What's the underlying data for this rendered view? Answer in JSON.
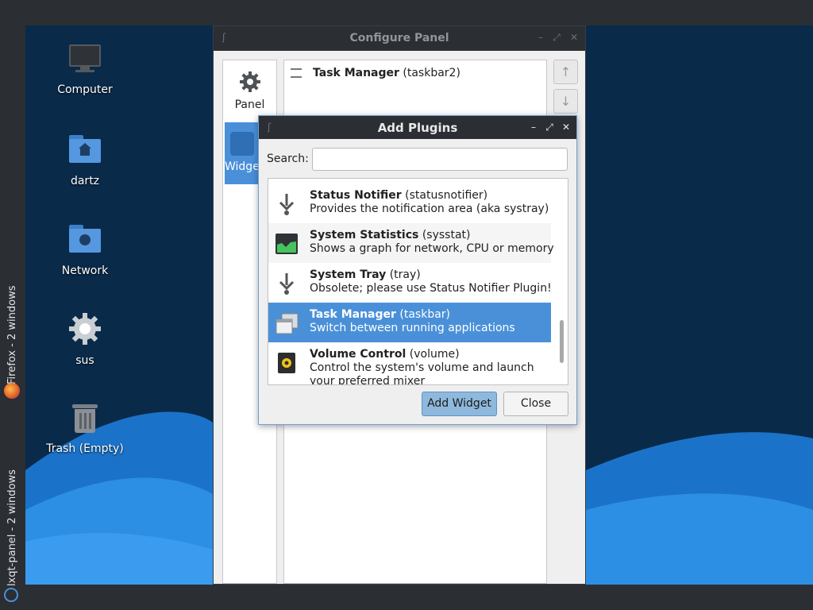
{
  "colors": {
    "accent": "#4a90d9",
    "panel": "#2b2e33",
    "wallpaper_dark": "#0a2a4a",
    "wallpaper_wave": "#1e7fd8"
  },
  "side_panel": {
    "tasks": [
      {
        "label": "Firefox - 2 windows",
        "icon": "firefox-icon"
      },
      {
        "label": "lxqt-panel - 2 windows",
        "icon": "lxqt-icon"
      }
    ]
  },
  "desktop": {
    "icons": [
      {
        "label": "Computer",
        "icon": "monitor-icon"
      },
      {
        "label": "dartz",
        "icon": "home-folder-icon"
      },
      {
        "label": "Network",
        "icon": "network-folder-icon"
      },
      {
        "label": "sus",
        "icon": "gear-icon"
      },
      {
        "label": "Trash (Empty)",
        "icon": "trash-icon"
      }
    ]
  },
  "configure_panel": {
    "title": "Configure Panel",
    "sidebar": [
      {
        "label": "Panel",
        "icon": "gear-icon"
      },
      {
        "label": "Widgets",
        "icon": "puzzle-icon"
      }
    ],
    "widgets": [
      {
        "name": "Task Manager",
        "id": "(taskbar2)"
      }
    ]
  },
  "add_plugins": {
    "title": "Add Plugins",
    "search_label": "Search:",
    "search_value": "",
    "plugins": [
      {
        "name": "Status Notifier",
        "id": "(statusnotifier)",
        "desc": "Provides the notification area (aka systray)",
        "icon": "download-arrow-icon"
      },
      {
        "name": "System Statistics",
        "id": "(sysstat)",
        "desc": "Shows a graph for network, CPU or memory",
        "icon": "graph-icon"
      },
      {
        "name": "System Tray",
        "id": "(tray)",
        "desc": "Obsolete; please use Status Notifier Plugin!",
        "icon": "download-arrow-icon"
      },
      {
        "name": "Task Manager",
        "id": "(taskbar)",
        "desc": "Switch between running applications",
        "icon": "windows-icon"
      },
      {
        "name": "Volume Control",
        "id": "(volume)",
        "desc": "Control the system's volume and launch your preferred mixer",
        "icon": "speaker-icon"
      }
    ],
    "add_label": "Add Widget",
    "close_label": "Close"
  }
}
